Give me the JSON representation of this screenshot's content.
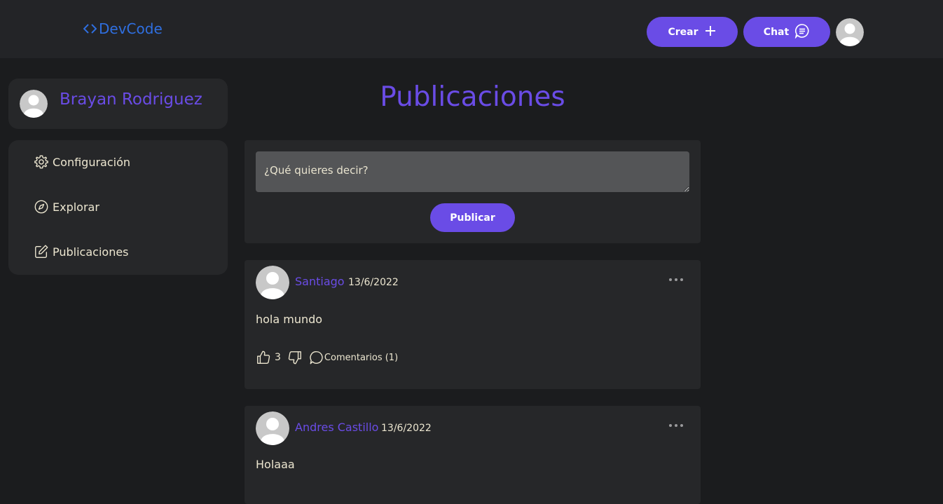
{
  "header": {
    "logo_text": "DevCode",
    "crear_label": "Crear",
    "chat_label": "Chat"
  },
  "sidebar": {
    "profile_name": "Brayan Rodriguez",
    "items": [
      {
        "label": "Configuración",
        "icon": "gear-icon"
      },
      {
        "label": "Explorar",
        "icon": "compass-icon"
      },
      {
        "label": "Publicaciones",
        "icon": "edit-icon"
      }
    ]
  },
  "main": {
    "title": "Publicaciones",
    "composer": {
      "placeholder": "¿Qué quieres decir?",
      "publish_label": "Publicar"
    },
    "posts": [
      {
        "author": "Santiago",
        "date": "13/6/2022",
        "body": "hola mundo",
        "likes": "3",
        "comments_label": "Comentarios (1)"
      },
      {
        "author": "Andres Castillo",
        "date": "13/6/2022",
        "body": "Holaaa"
      }
    ]
  },
  "colors": {
    "accent": "#6a4ce6",
    "logo": "#2f6fe0",
    "background": "#1b1c1e",
    "card": "#262729",
    "header": "#232427"
  }
}
